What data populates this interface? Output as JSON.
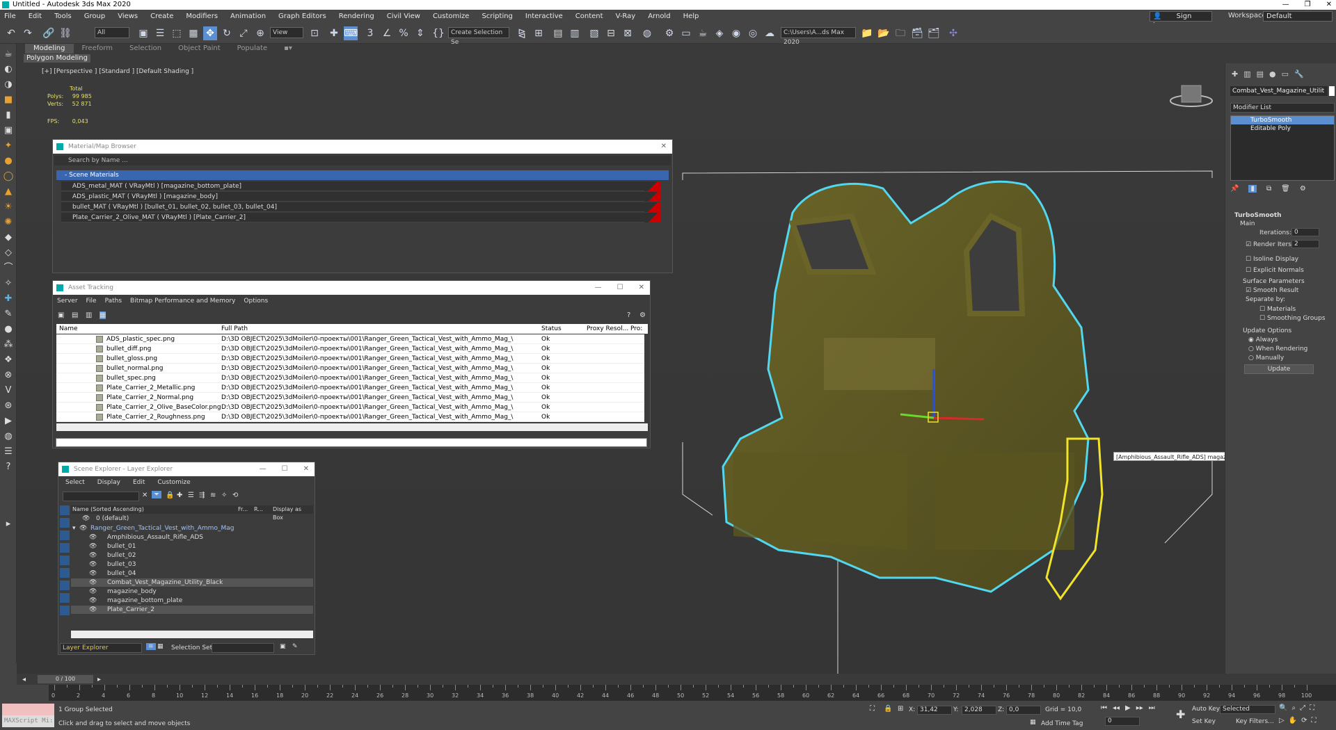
{
  "app": {
    "title": "Untitled - Autodesk 3ds Max 2020"
  },
  "menu": [
    "File",
    "Edit",
    "Tools",
    "Group",
    "Views",
    "Create",
    "Modifiers",
    "Animation",
    "Graph Editors",
    "Rendering",
    "Civil View",
    "Customize",
    "Scripting",
    "Interactive",
    "Content",
    "V-Ray",
    "Arnold",
    "Help"
  ],
  "account": {
    "sign_in": "Sign In",
    "workspaces_label": "Workspaces:",
    "workspace": "Default"
  },
  "toolbar": {
    "selection_filter": "All",
    "ref_coord": "View",
    "create_selection_set": "Create Selection Se",
    "project_path": "C:\\Users\\A...ds Max 2020"
  },
  "ribbon": {
    "tabs": [
      "Modeling",
      "Freeform",
      "Selection",
      "Object Paint",
      "Populate"
    ],
    "active": "Modeling",
    "sub": "Polygon Modeling"
  },
  "viewport": {
    "label": "[+] [Perspective ] [Standard ] [Default Shading ]",
    "stats_total": "Total",
    "polys_label": "Polys:",
    "polys": "99 985",
    "verts_label": "Verts:",
    "verts": "52 871",
    "fps_label": "FPS:",
    "fps": "0,043",
    "tooltip": "[Amphibious_Assault_Rifle_ADS] magazine_body"
  },
  "material_browser": {
    "title": "Material/Map Browser",
    "search_placeholder": "Search by Name ...",
    "group": "- Scene Materials",
    "materials": [
      "ADS_metal_MAT ( VRayMtl ) [magazine_bottom_plate]",
      "ADS_plastic_MAT ( VRayMtl ) [magazine_body]",
      "bullet_MAT ( VRayMtl ) [bullet_01, bullet_02, bullet_03, bullet_04]",
      "Plate_Carrier_2_Olive_MAT ( VRayMtl ) [Plate_Carrier_2]"
    ]
  },
  "asset_tracking": {
    "title": "Asset Tracking",
    "menu": [
      "Server",
      "File",
      "Paths",
      "Bitmap Performance and Memory",
      "Options"
    ],
    "columns": [
      "Name",
      "Full Path",
      "Status",
      "Proxy Resol...",
      "Pro:"
    ],
    "rows": [
      {
        "name": "ADS_plastic_spec.png",
        "path": "D:\\3D OBJECT\\2025\\3dMoiler\\0-проекты\\001\\Ranger_Green_Tactical_Vest_with_Ammo_Mag_\\",
        "status": "Ok"
      },
      {
        "name": "bullet_diff.png",
        "path": "D:\\3D OBJECT\\2025\\3dMoiler\\0-проекты\\001\\Ranger_Green_Tactical_Vest_with_Ammo_Mag_\\",
        "status": "Ok"
      },
      {
        "name": "bullet_gloss.png",
        "path": "D:\\3D OBJECT\\2025\\3dMoiler\\0-проекты\\001\\Ranger_Green_Tactical_Vest_with_Ammo_Mag_\\",
        "status": "Ok"
      },
      {
        "name": "bullet_normal.png",
        "path": "D:\\3D OBJECT\\2025\\3dMoiler\\0-проекты\\001\\Ranger_Green_Tactical_Vest_with_Ammo_Mag_\\",
        "status": "Ok"
      },
      {
        "name": "bullet_spec.png",
        "path": "D:\\3D OBJECT\\2025\\3dMoiler\\0-проекты\\001\\Ranger_Green_Tactical_Vest_with_Ammo_Mag_\\",
        "status": "Ok"
      },
      {
        "name": "Plate_Carrier_2_Metallic.png",
        "path": "D:\\3D OBJECT\\2025\\3dMoiler\\0-проекты\\001\\Ranger_Green_Tactical_Vest_with_Ammo_Mag_\\",
        "status": "Ok"
      },
      {
        "name": "Plate_Carrier_2_Normal.png",
        "path": "D:\\3D OBJECT\\2025\\3dMoiler\\0-проекты\\001\\Ranger_Green_Tactical_Vest_with_Ammo_Mag_\\",
        "status": "Ok"
      },
      {
        "name": "Plate_Carrier_2_Olive_BaseColor.png",
        "path": "D:\\3D OBJECT\\2025\\3dMoiler\\0-проекты\\001\\Ranger_Green_Tactical_Vest_with_Ammo_Mag_\\",
        "status": "Ok"
      },
      {
        "name": "Plate_Carrier_2_Roughness.png",
        "path": "D:\\3D OBJECT\\2025\\3dMoiler\\0-проекты\\001\\Ranger_Green_Tactical_Vest_with_Ammo_Mag_\\",
        "status": "Ok"
      }
    ]
  },
  "scene_explorer": {
    "title": "Scene Explorer - Layer Explorer",
    "menu": [
      "Select",
      "Display",
      "Edit",
      "Customize"
    ],
    "columns": [
      "Name (Sorted Ascending)",
      "Fr...",
      "R...",
      "Display as Box"
    ],
    "rows": [
      {
        "name": "0 (default)",
        "level": 0
      },
      {
        "name": "Ranger_Green_Tactical_Vest_with_Ammo_Mag",
        "level": 0
      },
      {
        "name": "Amphibious_Assault_Rifle_ADS",
        "level": 1
      },
      {
        "name": "bullet_01",
        "level": 1
      },
      {
        "name": "bullet_02",
        "level": 1
      },
      {
        "name": "bullet_03",
        "level": 1
      },
      {
        "name": "bullet_04",
        "level": 1
      },
      {
        "name": "Combat_Vest_Magazine_Utility_Black",
        "level": 1
      },
      {
        "name": "magazine_body",
        "level": 1
      },
      {
        "name": "magazine_bottom_plate",
        "level": 1
      },
      {
        "name": "Plate_Carrier_2",
        "level": 1
      }
    ],
    "footer_explorer": "Layer Explorer",
    "selection_set_label": "Selection Set:"
  },
  "command_panel": {
    "object_name": "Combat_Vest_Magazine_Utilit",
    "modifier_list": "Modifier List",
    "stack": [
      "TurboSmooth",
      "Editable Poly"
    ],
    "rollout": "TurboSmooth",
    "main": "Main",
    "iterations_label": "Iterations:",
    "iterations": "0",
    "render_iters_label": "Render Iters:",
    "render_iters": "2",
    "isoline": "Isoline Display",
    "explicit_normals": "Explicit Normals",
    "surface_params": "Surface Parameters",
    "smooth_result": "Smooth Result",
    "separate_by": "Separate by:",
    "materials": "Materials",
    "smoothing_groups": "Smoothing Groups",
    "update_options": "Update Options",
    "always": "Always",
    "when_rendering": "When Rendering",
    "manually": "Manually",
    "update_button": "Update"
  },
  "timeline": {
    "frame": "0 / 100",
    "ticks": [
      "0",
      "2",
      "4",
      "6",
      "8",
      "10",
      "12",
      "14",
      "16",
      "18",
      "20",
      "22",
      "24",
      "26",
      "28",
      "30",
      "32",
      "34",
      "36",
      "38",
      "40",
      "42",
      "44",
      "46",
      "48",
      "50",
      "52",
      "54",
      "56",
      "58",
      "60",
      "62",
      "64",
      "66",
      "68",
      "70",
      "72",
      "74",
      "76",
      "78",
      "80",
      "82",
      "84",
      "86",
      "88",
      "90",
      "92",
      "94",
      "96",
      "98",
      "100"
    ]
  },
  "status": {
    "maxscript": "MAXScript Mi:",
    "selection": "1 Group Selected",
    "prompt": "Click and drag to select and move objects",
    "x_label": "X:",
    "x": "31,42",
    "y_label": "Y:",
    "y": "2,028",
    "z_label": "Z:",
    "z": "0,0",
    "grid": "Grid = 10,0",
    "add_time_tag": "Add Time Tag",
    "auto_key": "Auto Key",
    "selected": "Selected",
    "set_key": "Set Key",
    "key_filters": "Key Filters...",
    "frame_field": "0"
  }
}
